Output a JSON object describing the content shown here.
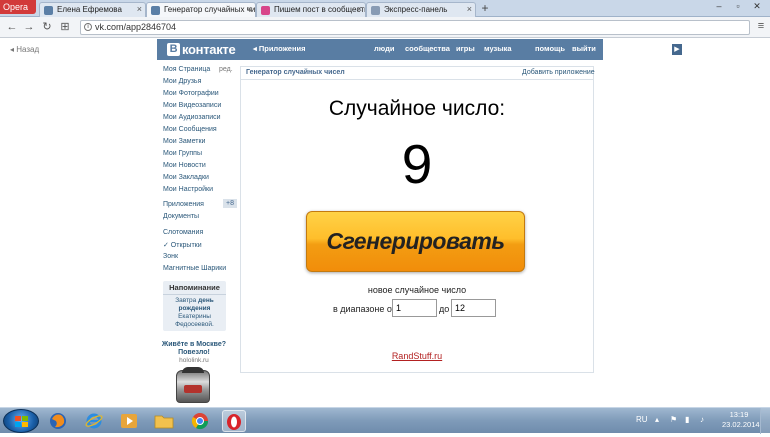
{
  "browser": {
    "menu_label": "Opera",
    "tabs": [
      {
        "label": "Елена Ефремова",
        "active": false
      },
      {
        "label": "Генератор случайных чисел",
        "active": true
      },
      {
        "label": "Пишем пост в сообществе",
        "active": false
      },
      {
        "label": "Экспресс-панель",
        "active": false
      }
    ],
    "new_tab_icon": "+",
    "url": "vk.com/app2846704",
    "back_label": "Назад"
  },
  "vk": {
    "logo_text": "контакте",
    "logo_badge": "В",
    "apps_link": "◂ Приложения",
    "nav": [
      "люди",
      "сообщества",
      "игры",
      "музыка",
      "помощь",
      "выйти"
    ],
    "sidebar": {
      "menu": [
        "Моя Страница",
        "Мои Друзья",
        "Мои Фотографии",
        "Мои Видеозаписи",
        "Мои Аудиозаписи",
        "Мои Сообщения",
        "Мои Заметки",
        "Мои Группы",
        "Мои Новости",
        "Мои Закладки",
        "Мои Настройки"
      ],
      "edit_label": "ред.",
      "apps_item": "Приложения",
      "apps_badge": "+8",
      "docs_item": "Документы",
      "games": [
        "Слотомания",
        "✓ Открытки",
        "Зонк",
        "Магнитные Шарики"
      ]
    },
    "reminder": {
      "title": "Напоминание",
      "line1": "Завтра ",
      "line1_bold": "день рождения",
      "line2": "Екатерины Федосеевой."
    },
    "ad": {
      "title": "Живёте в Москве? Повезло!",
      "url": "hololink.ru"
    }
  },
  "app": {
    "title": "Генератор случайных чисел",
    "add_label": "Добавить приложение",
    "heading": "Случайное число:",
    "number": "9",
    "button_label": "Сгенерировать",
    "new_number_label": "новое случайное число",
    "range_from_label": "в диапазоне от",
    "range_from_value": "1",
    "range_to_label": "до",
    "range_to_value": "12",
    "footer_link": "RandStuff.ru"
  },
  "taskbar": {
    "lang": "RU",
    "time": "13:19",
    "date": "23.02.2014"
  }
}
